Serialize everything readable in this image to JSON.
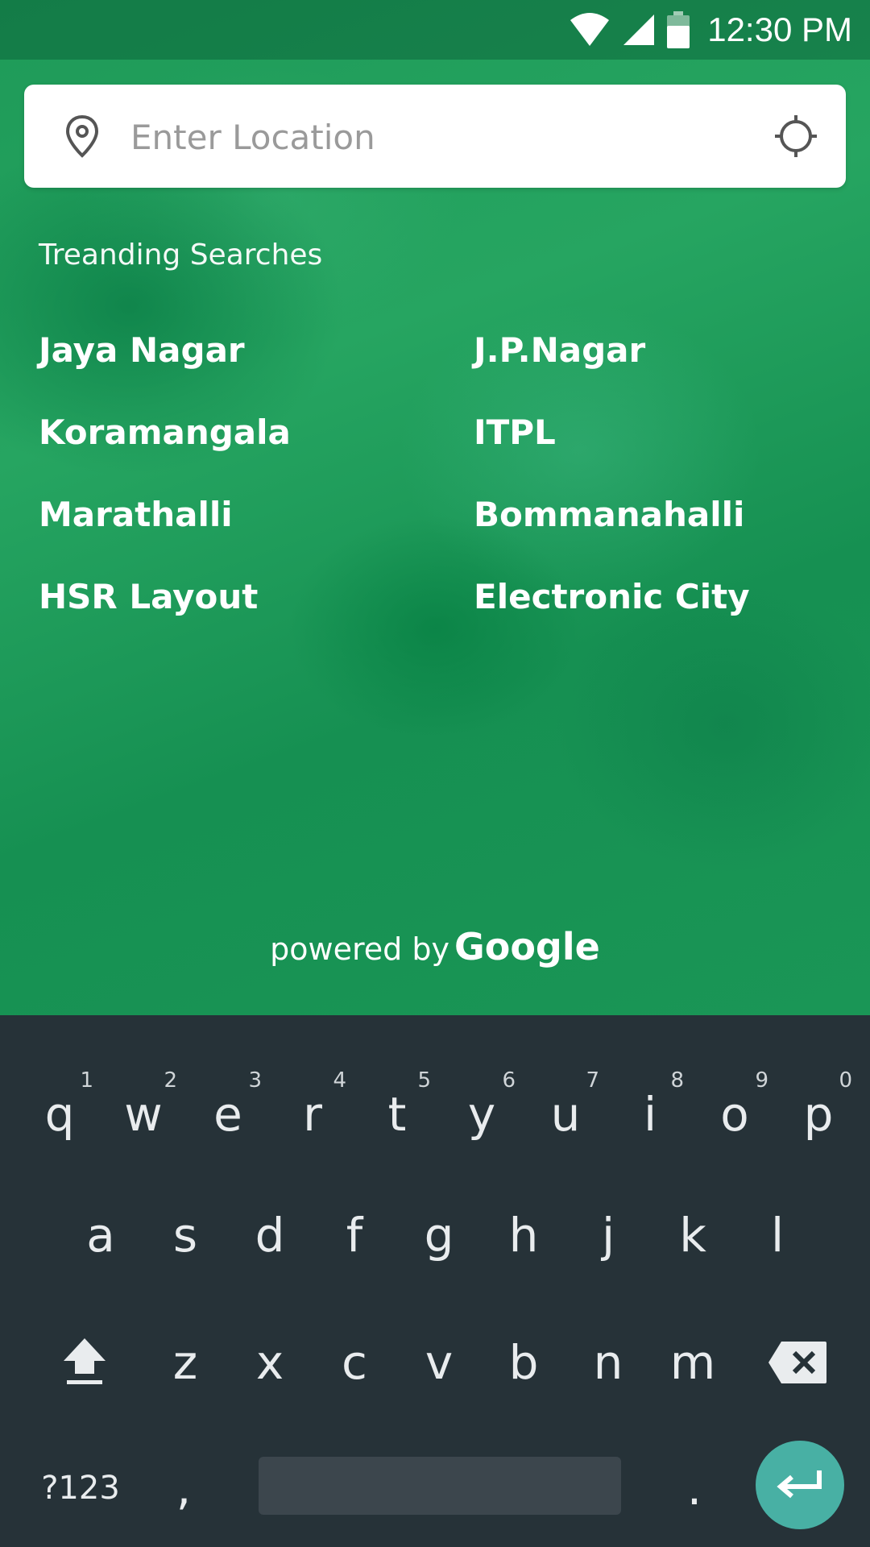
{
  "status_bar": {
    "time": "12:30 PM",
    "icons": [
      "wifi-icon",
      "cell-signal-icon",
      "battery-icon"
    ]
  },
  "search": {
    "placeholder": "Enter Location",
    "value": ""
  },
  "trending": {
    "title": "Treanding Searches",
    "left": [
      "Jaya Nagar",
      "Koramangala",
      "Marathalli",
      "HSR Layout"
    ],
    "right": [
      "J.P.Nagar",
      "ITPL",
      "Bommanahalli",
      "Electronic City"
    ]
  },
  "attribution": {
    "prefix": "powered by",
    "brand": "Google"
  },
  "keyboard": {
    "row1": [
      "q",
      "w",
      "e",
      "r",
      "t",
      "y",
      "u",
      "i",
      "o",
      "p"
    ],
    "row1_hints": [
      "1",
      "2",
      "3",
      "4",
      "5",
      "6",
      "7",
      "8",
      "9",
      "0"
    ],
    "row2": [
      "a",
      "s",
      "d",
      "f",
      "g",
      "h",
      "j",
      "k",
      "l"
    ],
    "row3": [
      "z",
      "x",
      "c",
      "v",
      "b",
      "n",
      "m"
    ],
    "symbols_label": "?123",
    "comma": ",",
    "period": ".",
    "special_keys": [
      "shift-icon",
      "backspace-icon",
      "enter-icon"
    ]
  },
  "colors": {
    "accent": "#48b0a4",
    "keyboard_bg": "#263238",
    "background_green": "#1e9a58"
  }
}
